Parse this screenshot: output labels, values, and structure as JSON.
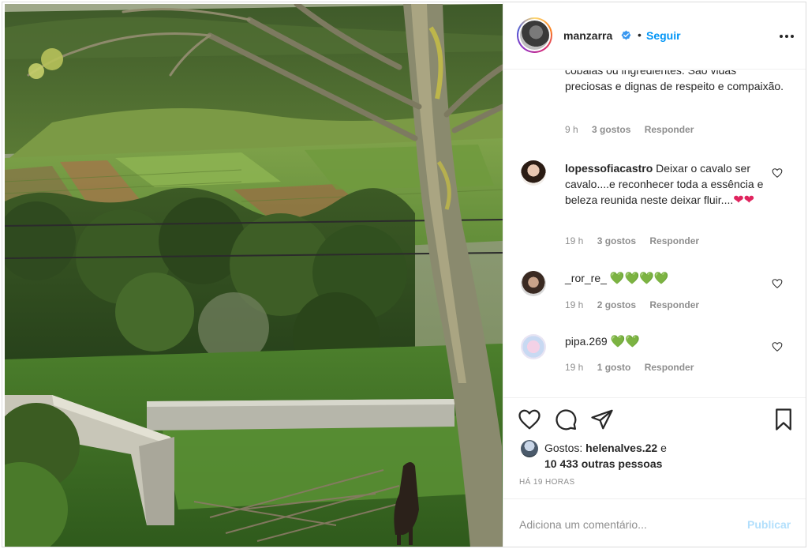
{
  "header": {
    "username": "manzarra",
    "dot": "•",
    "follow_label": "Seguir",
    "verified_icon": "verified-badge-icon",
    "more_icon": "more-options-icon"
  },
  "comments": [
    {
      "text": "cobaias ou ingredientes. São vidas preciosas e dignas de respeito e compaixão.",
      "time": "9 h",
      "likes": "3 gostos",
      "reply": "Responder"
    },
    {
      "username": "lopessofiacastro",
      "text": "Deixar o cavalo ser cavalo....e reconhecer toda a essência e beleza reunida neste deixar fluir....",
      "emoji": "❤❤",
      "time": "19 h",
      "likes": "3 gostos",
      "reply": "Responder"
    },
    {
      "username": "_ror_re_",
      "emoji": "💚💚💚💚",
      "time": "19 h",
      "likes": "2 gostos",
      "reply": "Responder"
    },
    {
      "username": "pipa.269",
      "emoji": "💚💚",
      "time": "19 h",
      "likes": "1 gosto",
      "reply": "Responder"
    }
  ],
  "likes": {
    "prefix": "Gostos:",
    "user": "helenalves.22",
    "conj": "e",
    "others": "10 433 outras pessoas"
  },
  "timestamp": "HÁ 19 HORAS",
  "add_comment": {
    "placeholder": "Adiciona um comentário...",
    "publish_label": "Publicar"
  },
  "colors": {
    "accent": "#0095f6",
    "publish_disabled": "#b2dffc",
    "muted": "#8e8e8e",
    "red_heart": "#e0245e",
    "green_heart": "#2ecc40"
  }
}
